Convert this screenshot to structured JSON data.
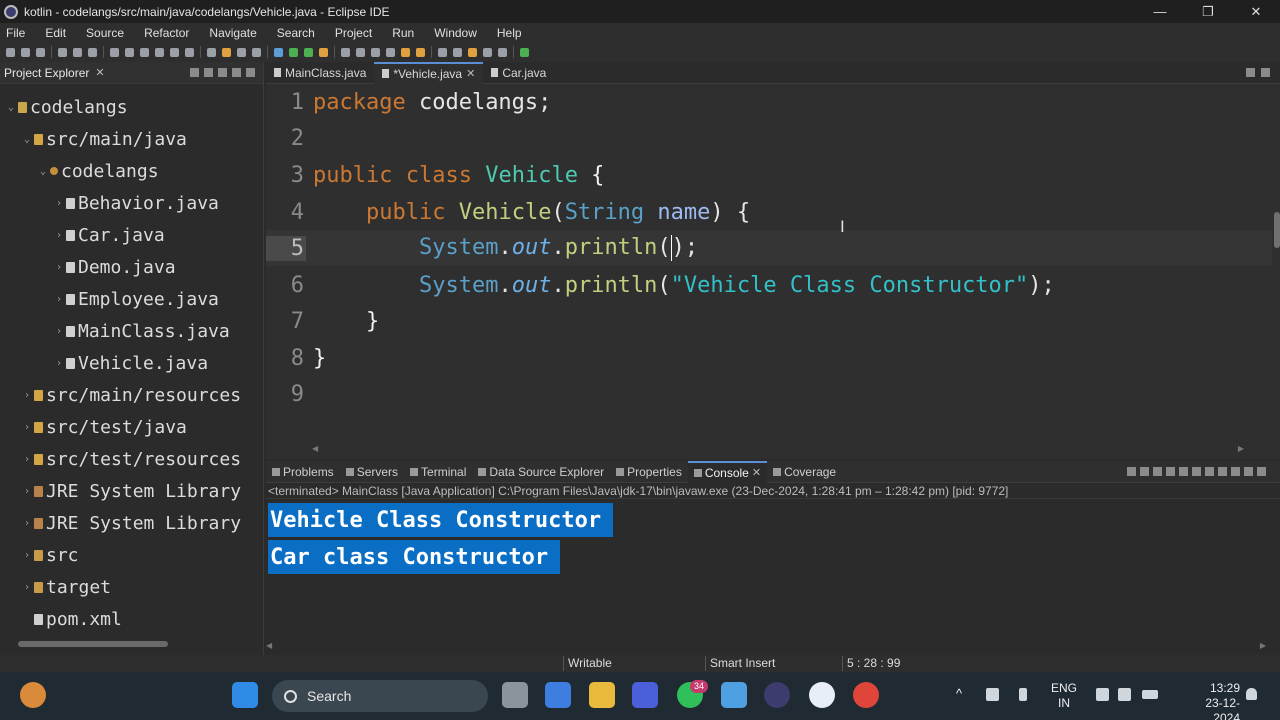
{
  "window": {
    "title": "kotlin - codelangs/src/main/java/codelangs/Vehicle.java - Eclipse IDE",
    "minimize": "—",
    "maximize": "❐",
    "close": "✕"
  },
  "menu": [
    "File",
    "Edit",
    "Source",
    "Refactor",
    "Navigate",
    "Search",
    "Project",
    "Run",
    "Window",
    "Help"
  ],
  "explorer": {
    "title": "Project Explorer",
    "items": [
      {
        "label": "codelangs",
        "icon": "project-icon",
        "expanded": true
      },
      {
        "label": "src/main/java",
        "icon": "source-folder-icon",
        "expanded": true
      },
      {
        "label": "codelangs",
        "icon": "package-icon",
        "expanded": true
      },
      {
        "label": "Behavior.java",
        "icon": "java-file-icon"
      },
      {
        "label": "Car.java",
        "icon": "java-file-icon"
      },
      {
        "label": "Demo.java",
        "icon": "java-file-icon"
      },
      {
        "label": "Employee.java",
        "icon": "java-file-icon"
      },
      {
        "label": "MainClass.java",
        "icon": "java-file-icon"
      },
      {
        "label": "Vehicle.java",
        "icon": "java-file-icon"
      },
      {
        "label": "src/main/resources",
        "icon": "source-folder-icon"
      },
      {
        "label": "src/test/java",
        "icon": "source-folder-icon"
      },
      {
        "label": "src/test/resources",
        "icon": "source-folder-icon"
      },
      {
        "label": "JRE System Library",
        "icon": "library-icon"
      },
      {
        "label": "JRE System Library",
        "icon": "library-icon"
      },
      {
        "label": "src",
        "icon": "folder-icon"
      },
      {
        "label": "target",
        "icon": "folder-icon"
      },
      {
        "label": "pom.xml",
        "icon": "xml-file-icon"
      }
    ]
  },
  "editor": {
    "tabs": [
      {
        "label": "MainClass.java",
        "active": false
      },
      {
        "label": "*Vehicle.java",
        "active": true
      },
      {
        "label": "Car.java",
        "active": false
      }
    ],
    "line_numbers": [
      "1",
      "2",
      "3",
      "4",
      "5",
      "6",
      "7",
      "8",
      "9"
    ],
    "code": {
      "l1_kw": "package",
      "l1_rest": " codelangs;",
      "l3_kw1": "public",
      "l3_kw2": "class",
      "l3_cls": "Vehicle",
      "l3_brace": " {",
      "l4_kw": "public",
      "l4_cls": "Vehicle",
      "l4_open": "(",
      "l4_type": "String",
      "l4_param": "name",
      "l4_close": ") {",
      "l5_sys": "System",
      "l5_dot1": ".",
      "l5_out": "out",
      "l5_dot2": ".",
      "l5_m": "println",
      "l5_args": "();",
      "l6_sys": "System",
      "l6_dot1": ".",
      "l6_out": "out",
      "l6_dot2": ".",
      "l6_m": "println",
      "l6_open": "(",
      "l6_str": "\"Vehicle Class Constructor\"",
      "l6_close": ");",
      "l7": "}",
      "l8": "}"
    }
  },
  "bottom_panel": {
    "tabs": [
      {
        "label": "Problems",
        "active": false
      },
      {
        "label": "Servers",
        "active": false
      },
      {
        "label": "Terminal",
        "active": false
      },
      {
        "label": "Data Source Explorer",
        "active": false
      },
      {
        "label": "Properties",
        "active": false
      },
      {
        "label": "Console",
        "active": true
      },
      {
        "label": "Coverage",
        "active": false
      }
    ],
    "console_status": "<terminated> MainClass [Java Application] C:\\Program Files\\Java\\jdk-17\\bin\\javaw.exe  (23-Dec-2024, 1:28:41 pm – 1:28:42 pm) [pid: 9772]",
    "output": [
      "Vehicle Class Constructor",
      "Car class Constructor"
    ]
  },
  "statusbar": {
    "mode": "Writable",
    "insert": "Smart Insert",
    "position": "5 : 28 : 99"
  },
  "taskbar": {
    "search": "Search",
    "whatsapp_badge": "34",
    "lang_line1": "ENG",
    "lang_line2": "IN",
    "time": "13:29",
    "date": "23-12-2024"
  },
  "colors": {
    "keyword": "#cc7832",
    "class": "#4ec9b0",
    "string": "#33c0c8",
    "console_selection": "#0a6fc4"
  }
}
